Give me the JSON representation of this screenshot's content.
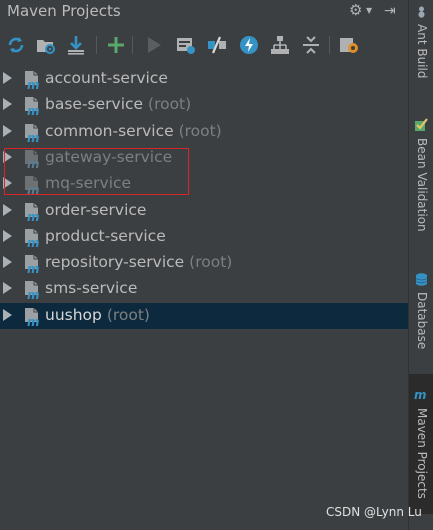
{
  "panel": {
    "title": "Maven Projects"
  },
  "toolbar": {
    "buttons": [
      {
        "icon": "reimport-icon",
        "color": "#3592c4"
      },
      {
        "icon": "generate-sources-icon",
        "color": "#afb1b3"
      },
      {
        "icon": "download-icon",
        "color": "#3592c4"
      },
      {
        "icon": "add-icon",
        "color": "#59a869"
      },
      {
        "icon": "run-icon",
        "color": "#5b5e60"
      },
      {
        "icon": "execute-goal-icon",
        "color": "#afb1b3"
      },
      {
        "icon": "toggle-offline-icon",
        "color": "#3592c4"
      },
      {
        "icon": "skip-tests-icon",
        "color": "#3592c4"
      },
      {
        "icon": "show-dependencies-icon",
        "color": "#afb1b3"
      },
      {
        "icon": "collapse-all-icon",
        "color": "#afb1b3"
      },
      {
        "icon": "settings-icon",
        "color": "#afb1b3"
      }
    ]
  },
  "tree": {
    "items": [
      {
        "name": "account-service",
        "suffix": "",
        "disabled": false,
        "selected": false
      },
      {
        "name": "base-service",
        "suffix": "(root)",
        "disabled": false,
        "selected": false
      },
      {
        "name": "common-service",
        "suffix": "(root)",
        "disabled": false,
        "selected": false
      },
      {
        "name": "gateway-service",
        "suffix": "",
        "disabled": true,
        "selected": false
      },
      {
        "name": "mq-service",
        "suffix": "",
        "disabled": true,
        "selected": false
      },
      {
        "name": "order-service",
        "suffix": "",
        "disabled": false,
        "selected": false
      },
      {
        "name": "product-service",
        "suffix": "",
        "disabled": false,
        "selected": false
      },
      {
        "name": "repository-service",
        "suffix": "(root)",
        "disabled": false,
        "selected": false
      },
      {
        "name": "sms-service",
        "suffix": "",
        "disabled": false,
        "selected": false
      },
      {
        "name": "uushop",
        "suffix": "(root)",
        "disabled": false,
        "selected": true
      }
    ]
  },
  "side_tabs": [
    {
      "label": "Ant Build",
      "icon": "ant-icon",
      "active": false
    },
    {
      "label": "Bean Validation",
      "icon": "bean-validation-icon",
      "active": false
    },
    {
      "label": "Database",
      "icon": "database-icon",
      "active": false
    },
    {
      "label": "Maven Projects",
      "icon": "maven-icon",
      "active": true
    }
  ],
  "colors": {
    "background": "#3c3f41",
    "selection": "#0d293e",
    "annotation_box": "#d7262a",
    "maven_module": "#3592c4"
  },
  "watermark": "CSDN @Lynn Lu"
}
